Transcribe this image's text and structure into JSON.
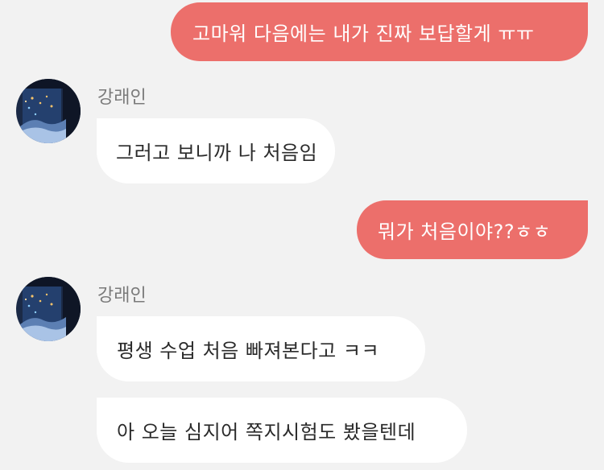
{
  "colors": {
    "background": "#f2f2f2",
    "outgoing_bubble": "#ec6f6b",
    "incoming_bubble": "#ffffff",
    "sender_name": "#7a7a7a"
  },
  "messages": [
    {
      "direction": "outgoing",
      "text": "고마워 다음에는 내가 진짜 보답할게 ㅠㅠ"
    },
    {
      "direction": "incoming",
      "sender": "강래인",
      "text": "그러고 보니까 나 처음임"
    },
    {
      "direction": "outgoing",
      "text": "뭐가 처음이야??ㅎㅎ"
    },
    {
      "direction": "incoming",
      "sender": "강래인",
      "text": "평생 수업 처음 빠져본다고 ㅋㅋ"
    },
    {
      "direction": "incoming",
      "text": "아 오늘 심지어 쪽지시험도 봤을텐데"
    }
  ],
  "avatar": {
    "icon": "night-window-photo-icon"
  }
}
